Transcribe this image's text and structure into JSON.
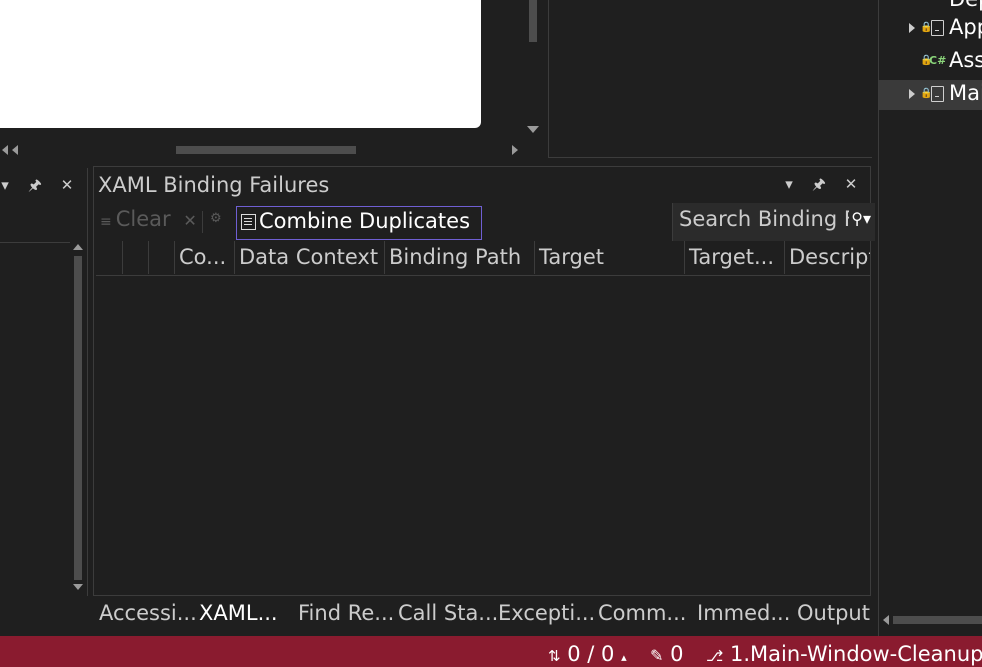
{
  "xaml_panel": {
    "title": "XAML Binding Failures",
    "toolbar": {
      "clear_label": "Clear",
      "combine_label": "Combine Duplicates"
    },
    "search_placeholder": "Search Binding F",
    "columns": [
      "Co...",
      "Data Context",
      "Binding Path",
      "Target",
      "Target...",
      "Descripti"
    ]
  },
  "solution_explorer": {
    "items": [
      {
        "label": "Dep"
      },
      {
        "label": "App"
      },
      {
        "label": "Ass"
      },
      {
        "label": "Mai"
      }
    ]
  },
  "bottom_tabs": [
    "Accessi...",
    "XAML...",
    "Find Re...",
    "Call Sta...",
    "Excepti...",
    "Comm...",
    "Immed...",
    "Output"
  ],
  "status_bar": {
    "sync": "0 / 0",
    "edits": "0",
    "branch": "1.Main-Window-Cleanup"
  },
  "colors": {
    "status_bar_bg": "#8a1b2f",
    "panel_bg": "#1f1f1f",
    "combine_border": "#6f5fd3"
  }
}
